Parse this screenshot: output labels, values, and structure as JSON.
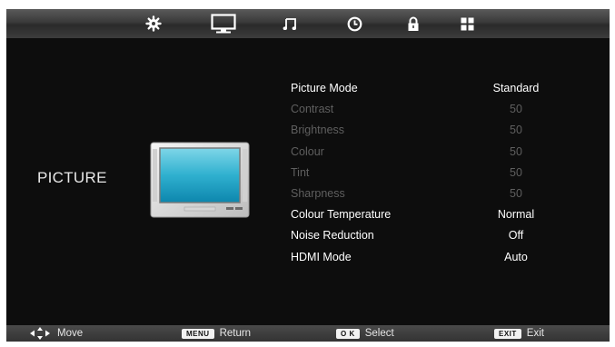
{
  "topbar": {
    "icons": [
      "gear-icon",
      "monitor-icon",
      "music-note-icon",
      "clock-icon",
      "lock-icon",
      "grid-icon"
    ],
    "active": "monitor-icon"
  },
  "page": {
    "title": "PICTURE"
  },
  "menu": {
    "items": [
      {
        "label": "Picture Mode",
        "value": "Standard",
        "enabled": true
      },
      {
        "label": "Contrast",
        "value": "50",
        "enabled": false
      },
      {
        "label": "Brightness",
        "value": "50",
        "enabled": false
      },
      {
        "label": "Colour",
        "value": "50",
        "enabled": false
      },
      {
        "label": "Tint",
        "value": "50",
        "enabled": false
      },
      {
        "label": "Sharpness",
        "value": "50",
        "enabled": false
      },
      {
        "label": "Colour Temperature",
        "value": "Normal",
        "enabled": true
      },
      {
        "label": "Noise Reduction",
        "value": "Off",
        "enabled": true
      },
      {
        "label": "HDMI Mode",
        "value": "Auto",
        "enabled": true
      }
    ]
  },
  "bottombar": {
    "move": {
      "label": "Move"
    },
    "menu": {
      "key": "MENU",
      "label": "Return"
    },
    "ok": {
      "key": "O K",
      "label": "Select"
    },
    "exit": {
      "key": "EXIT",
      "label": "Exit"
    }
  },
  "colors": {
    "background": "#0d0d0d",
    "enabled_text": "#ffffff",
    "disabled_text": "#5f5f5f"
  }
}
